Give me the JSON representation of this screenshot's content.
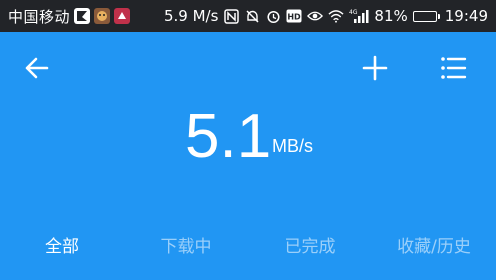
{
  "status_bar": {
    "carrier": "中国移动",
    "speed": "5.9 M/s",
    "network": "4G",
    "battery": "81%",
    "battery_level": 0.81,
    "time": "19:49",
    "icons": [
      "app-icon-1",
      "app-icon-2",
      "app-icon-3",
      "nfc-icon",
      "mute-icon",
      "alarm-icon",
      "hd-icon",
      "eye-icon",
      "wifi-icon",
      "signal-icon",
      "battery-icon"
    ]
  },
  "toolbar": {
    "back_icon": "arrow-left-icon",
    "add_icon": "plus-icon",
    "menu_icon": "list-icon"
  },
  "speed": {
    "value": "5.1",
    "unit": "MB/s"
  },
  "tabs": [
    {
      "label": "全部",
      "active": true
    },
    {
      "label": "下载中",
      "active": false
    },
    {
      "label": "已完成",
      "active": false
    },
    {
      "label": "收藏/历史",
      "active": false
    }
  ],
  "colors": {
    "primary": "#2196F3",
    "status_bar": "#222428",
    "text": "#ffffff"
  }
}
